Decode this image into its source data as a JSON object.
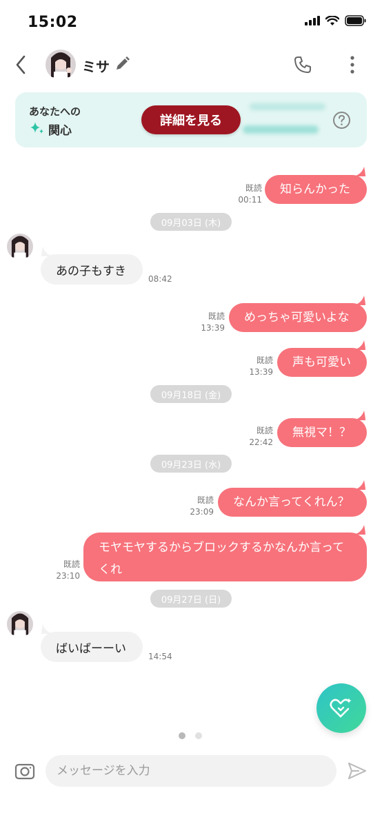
{
  "status": {
    "time": "15:02"
  },
  "header": {
    "name": "ミサ"
  },
  "banner": {
    "line1": "あなたへの",
    "line2": "関心",
    "button": "詳細を見る"
  },
  "messages": [
    {
      "dir": "out",
      "text": "知らんかった",
      "read": "既読",
      "time": "00:11"
    },
    {
      "dir": "date",
      "text": "09月03日 (木)"
    },
    {
      "dir": "in",
      "text": "あの子もすき",
      "time": "08:42"
    },
    {
      "dir": "out",
      "text": "めっちゃ可愛いよな",
      "read": "既読",
      "time": "13:39"
    },
    {
      "dir": "out",
      "text": "声も可愛い",
      "read": "既読",
      "time": "13:39"
    },
    {
      "dir": "date",
      "text": "09月18日 (金)"
    },
    {
      "dir": "out",
      "text": "無視マ！？",
      "read": "既読",
      "time": "22:42"
    },
    {
      "dir": "date",
      "text": "09月23日 (水)"
    },
    {
      "dir": "out",
      "text": "なんか言ってくれん？",
      "read": "既読",
      "time": "23:09"
    },
    {
      "dir": "out",
      "text": "モヤモヤするからブロックするかなんか言ってくれ",
      "read": "既読",
      "time": "23:10"
    },
    {
      "dir": "date",
      "text": "09月27日 (日)"
    },
    {
      "dir": "in",
      "text": "ばいばーーい",
      "time": "14:54"
    }
  ],
  "input": {
    "placeholder": "メッセージを入力",
    "value": ""
  },
  "colors": {
    "outgoing_bubble": "#f7727b",
    "incoming_bubble": "#f2f2f2",
    "banner_bg": "#e3f6f3",
    "detail_button": "#9e1622",
    "fab_gradient_start": "#2fc4c7",
    "fab_gradient_end": "#41d89a"
  },
  "icons": {
    "back": "chevron-left-icon",
    "edit": "pencil-icon",
    "call": "phone-icon",
    "more": "more-vertical-icon",
    "interest": "sparkle-icon",
    "help": "question-circle-icon",
    "fab": "heart-sparkle-icon",
    "camera": "camera-icon",
    "send": "send-icon"
  },
  "pager": {
    "pages": 2,
    "active": 1
  }
}
